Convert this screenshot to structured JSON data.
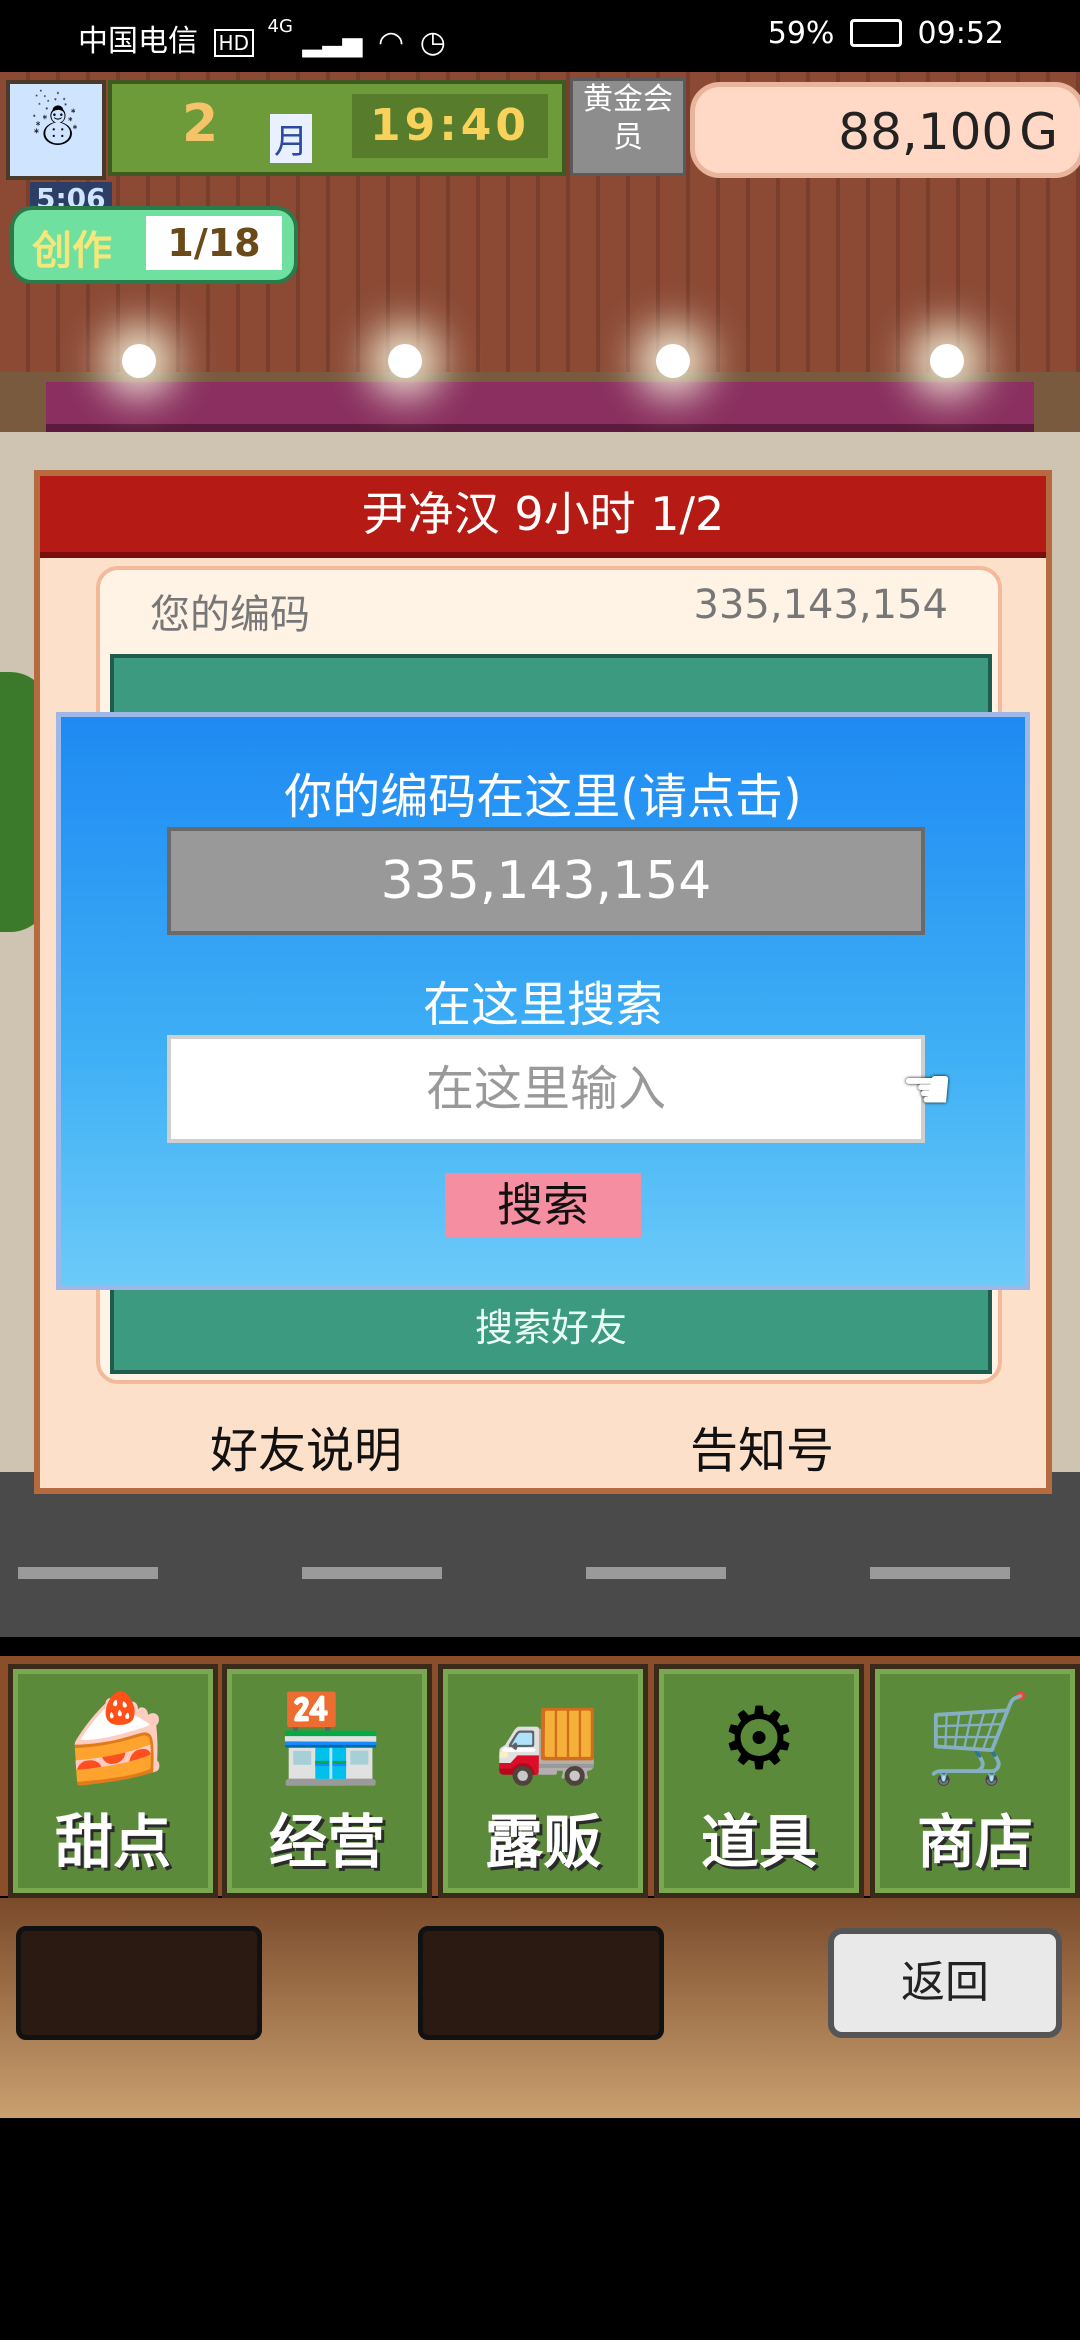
{
  "status_bar": {
    "carrier": "中国电信",
    "network": "4G",
    "battery": "59%",
    "time": "09:52"
  },
  "hud": {
    "month_number": "2",
    "month_unit": "月",
    "clock": "19:40",
    "gold_member": "黄金会员",
    "money": "88,100",
    "currency": "G",
    "create_timer": "5:06",
    "create_label": "创作",
    "create_count": "1/18"
  },
  "dialog": {
    "title": "尹净汉  9小时 1/2",
    "code_label": "您的编码",
    "code_value": "335,143,154",
    "panel_button": "搜索好友",
    "friend_note": "好友说明",
    "notice_no": "告知号"
  },
  "popup": {
    "title": "你的编码在这里(请点击)",
    "code": "335,143,154",
    "search_label": "在这里搜索",
    "search_placeholder": "在这里输入",
    "search_button": "搜索"
  },
  "nav": {
    "items": [
      {
        "label": "甜点",
        "icon": "cake-icon"
      },
      {
        "label": "经营",
        "icon": "shop-front-icon"
      },
      {
        "label": "露贩",
        "icon": "food-truck-icon"
      },
      {
        "label": "道具",
        "icon": "items-bag-icon"
      },
      {
        "label": "商店",
        "icon": "shopping-cart-icon"
      }
    ]
  },
  "back_label": "返回"
}
